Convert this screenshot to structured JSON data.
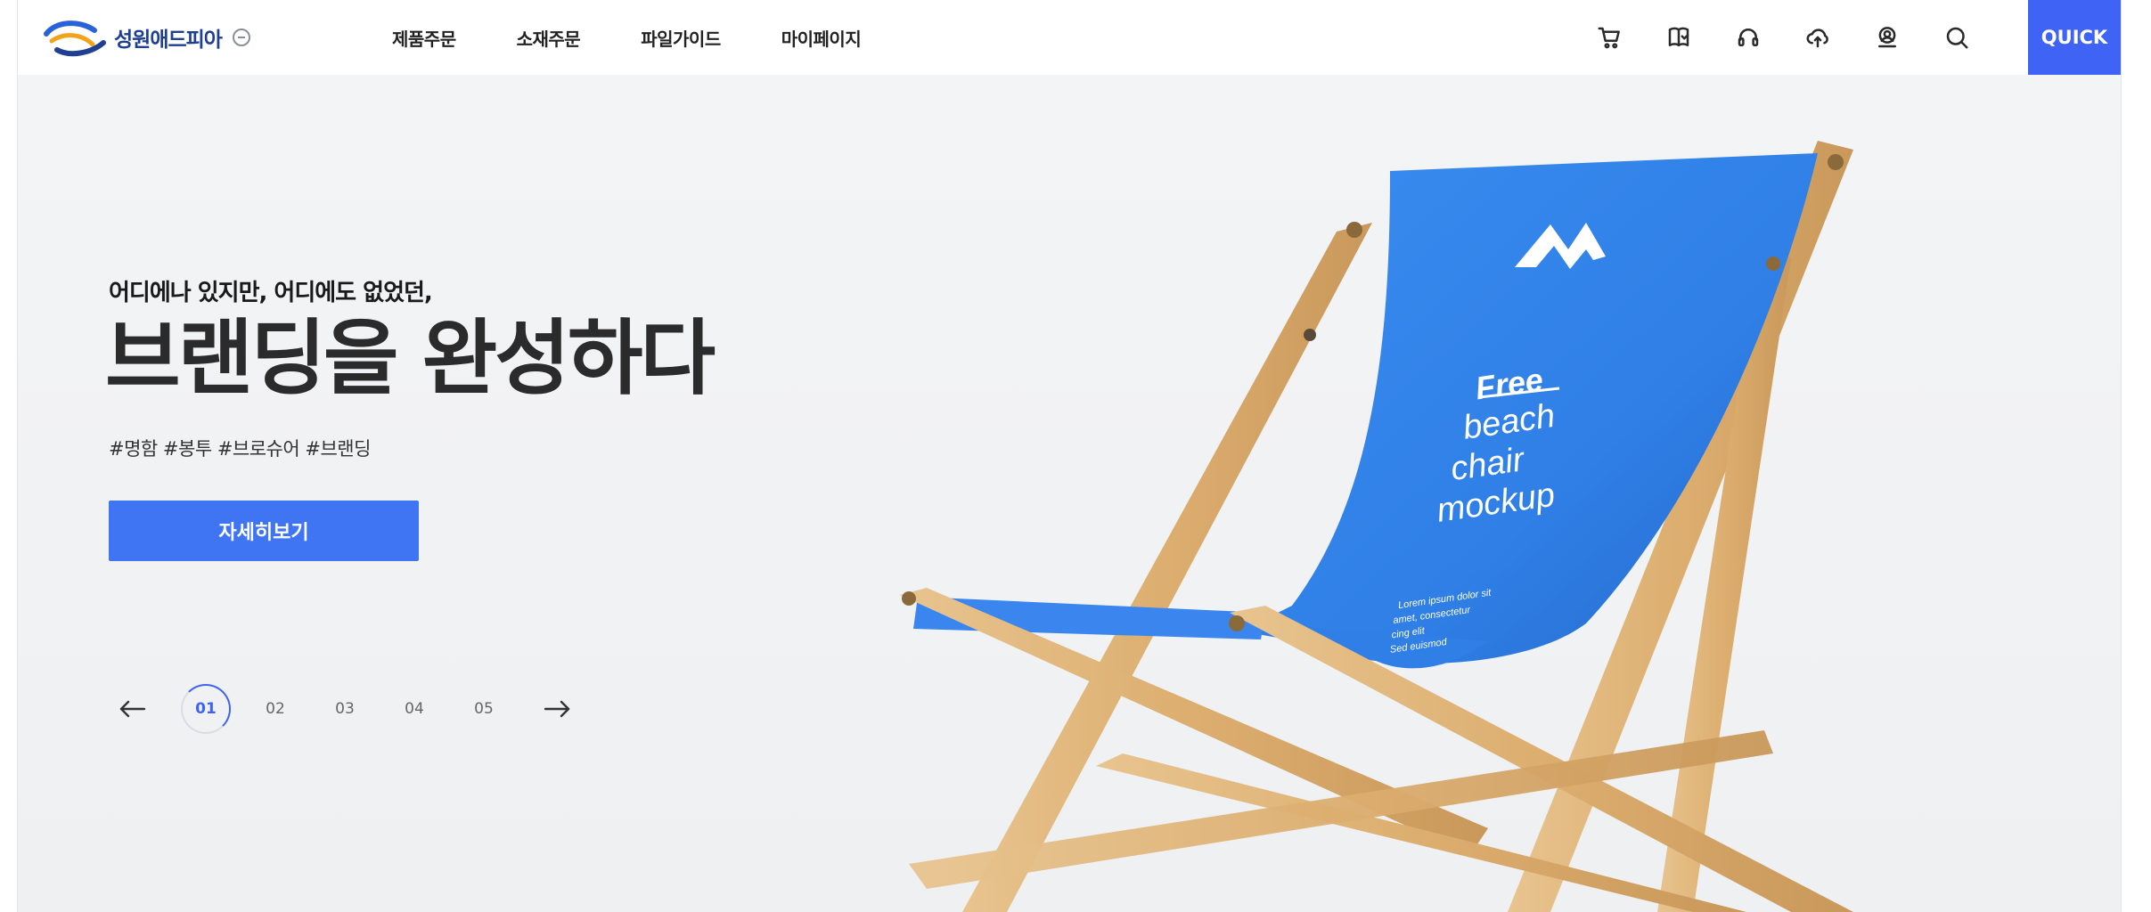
{
  "header": {
    "logo_text": "성원애드피아",
    "nav": [
      "제품주문",
      "소재주문",
      "파일가이드",
      "마이페이지"
    ],
    "icons": [
      "cart-icon",
      "book-icon",
      "headset-icon",
      "cloud-upload-icon",
      "user-icon",
      "search-icon"
    ],
    "quick_label": "QUICK"
  },
  "hero": {
    "subtitle": "어디에나 있지만, 어디에도 없었던,",
    "title": "브랜딩을 완성하다",
    "tags": "#명함 #봉투 #브로슈어 #브랜딩",
    "button_label": "자세히보기",
    "image_text": {
      "line1": "Free",
      "line2": "beach",
      "line3": "chair",
      "line4": "mockup",
      "fine_print": [
        "Lorem ipsum dolor sit",
        "amet, consectetur",
        "cing elit",
        "Sed euismod"
      ]
    }
  },
  "slider": {
    "pages": [
      "01",
      "02",
      "03",
      "04",
      "05"
    ],
    "active": "01"
  },
  "colors": {
    "accent": "#3f63f5",
    "button": "#3f74f2",
    "chair_fabric": "#2f7fe6",
    "wood": "#dfb57a"
  }
}
